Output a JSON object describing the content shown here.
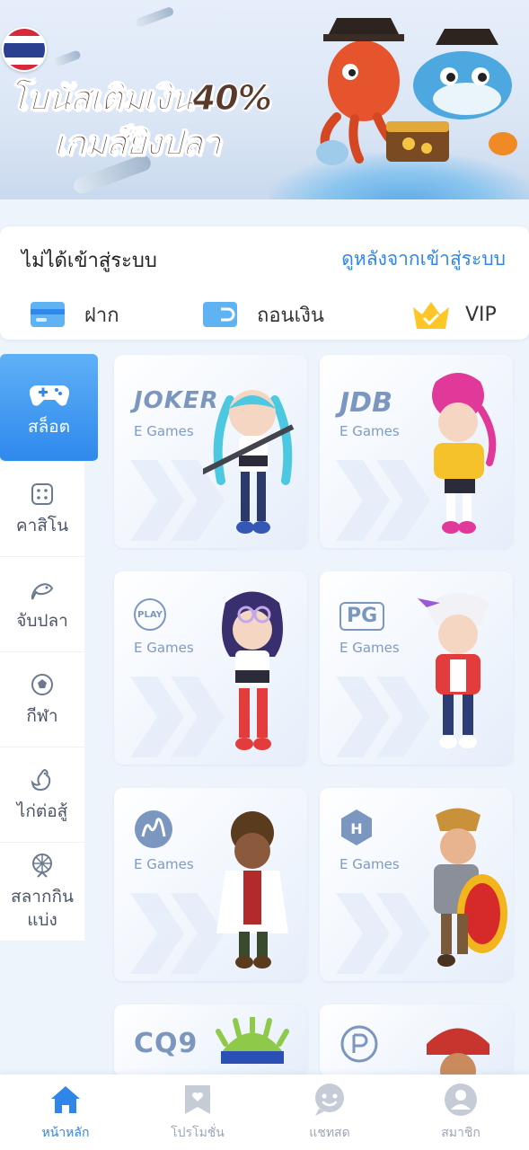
{
  "banner": {
    "line1": "โบนัสเติมเงิน40%",
    "line2": "เกมส์ยิงปลา",
    "flag_icon": "thailand-flag-icon"
  },
  "account": {
    "status": "ไม่ได้เข้าสู่ระบบ",
    "login_link": "ดูหลังจากเข้าสู่ระบบ",
    "actions": [
      {
        "label": "ฝาก",
        "icon": "deposit-card-icon"
      },
      {
        "label": "ถอนเงิน",
        "icon": "withdraw-card-icon"
      },
      {
        "label": "VIP",
        "icon": "vip-crown-icon"
      }
    ]
  },
  "sidenav": {
    "items": [
      {
        "label": "สล็อต",
        "icon": "gamepad-icon",
        "active": true
      },
      {
        "label": "คาสิโน",
        "icon": "dice-icon"
      },
      {
        "label": "จับปลา",
        "icon": "fish-icon"
      },
      {
        "label": "กีฬา",
        "icon": "soccer-ball-icon"
      },
      {
        "label": "ไก่ต่อสู้",
        "icon": "rooster-icon"
      },
      {
        "label": "สลากกินแบ่ง",
        "label_line1": "สลากกิน",
        "label_line2": "แบ่ง",
        "icon": "lottery-wheel-icon"
      }
    ]
  },
  "games": [
    {
      "provider": "JOKER",
      "subtitle": "E Games",
      "logo": "joker-logo"
    },
    {
      "provider": "JDB",
      "subtitle": "E Games",
      "logo": "jdb-logo"
    },
    {
      "provider": "PLAY",
      "subtitle": "E Games",
      "logo": "pragmatic-play-logo"
    },
    {
      "provider": "PG",
      "subtitle": "E Games",
      "logo": "pg-logo"
    },
    {
      "provider": "",
      "subtitle": "E Games",
      "logo": "microgaming-logo"
    },
    {
      "provider": "",
      "subtitle": "E Games",
      "logo": "habanero-logo"
    },
    {
      "provider": "CQ9",
      "subtitle": "",
      "logo": "cq9-logo"
    },
    {
      "provider": "",
      "subtitle": "",
      "logo": "dreamtech-logo"
    }
  ],
  "tabbar": {
    "tabs": [
      {
        "label": "หน้าหลัก",
        "icon": "home-icon",
        "active": true
      },
      {
        "label": "โปรโมชั่น",
        "icon": "promotion-icon"
      },
      {
        "label": "แชทสด",
        "icon": "chat-icon"
      },
      {
        "label": "สมาชิก",
        "icon": "user-icon"
      }
    ]
  },
  "colors": {
    "accent": "#2f86e8",
    "active_nav_top": "#5fb0f7",
    "active_nav_bottom": "#2f89ec",
    "background": "#eef4fc"
  }
}
